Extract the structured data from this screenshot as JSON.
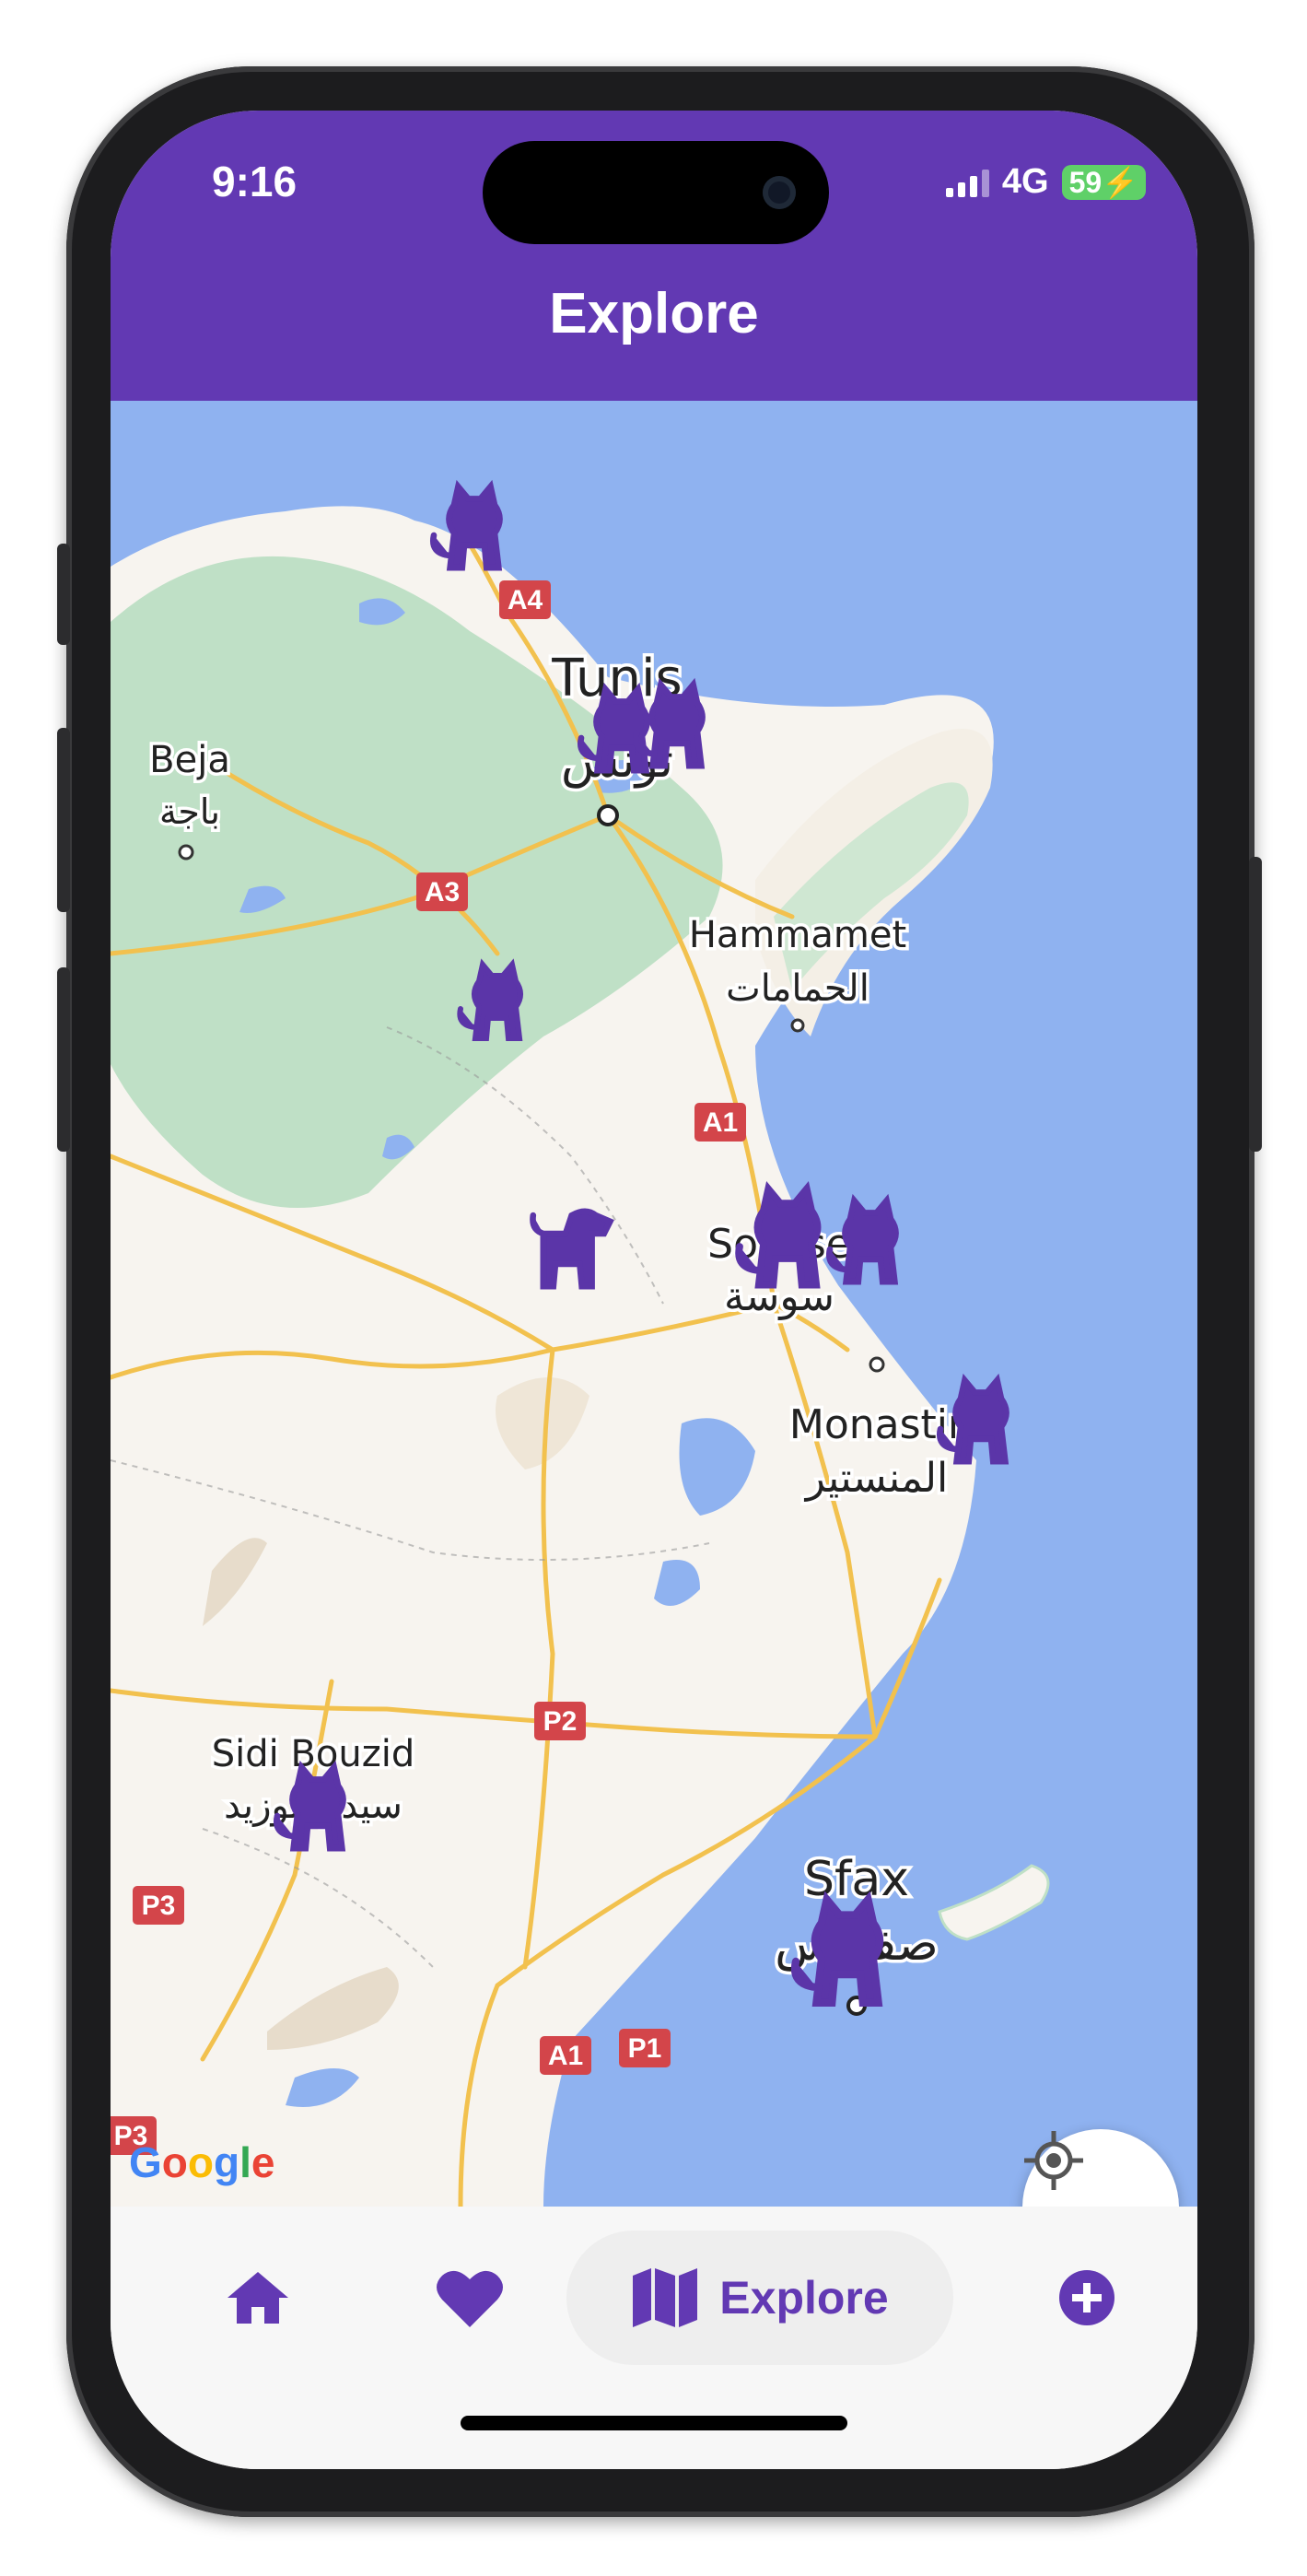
{
  "status_bar": {
    "time": "9:16",
    "network": "4G",
    "battery": "59"
  },
  "header": {
    "title": "Explore"
  },
  "map": {
    "attribution": "Google",
    "cities": [
      {
        "id": "tunis",
        "name": "Tunis",
        "name_ar": "تونس"
      },
      {
        "id": "beja",
        "name": "Beja",
        "name_ar": "باجة"
      },
      {
        "id": "hammamet",
        "name": "Hammamet",
        "name_ar": "الحمامات"
      },
      {
        "id": "sousse",
        "name": "Sousse",
        "name_ar": "سوسة"
      },
      {
        "id": "monastir",
        "name": "Monastir",
        "name_ar": "المنستير"
      },
      {
        "id": "sidi_bouzid",
        "name": "Sidi Bouzid",
        "name_ar": "سيدي بوزيد"
      },
      {
        "id": "sfax",
        "name": "Sfax",
        "name_ar": "صفاقس"
      }
    ],
    "roads": [
      "A4",
      "A3",
      "A1",
      "P2",
      "P3",
      "A1",
      "P1",
      "P3"
    ],
    "pet_markers": [
      "cat",
      "cat",
      "cat",
      "dog",
      "cat",
      "cat",
      "cat",
      "cat",
      "cat",
      "cat"
    ],
    "colors": {
      "water": "#8fb2f0",
      "land": "#f7f4ef",
      "forest": "#bfe0c6",
      "road": "#f2c14e",
      "marker": "#5b35a8",
      "shield": "#d3454a"
    }
  },
  "nav": {
    "items": [
      {
        "id": "home",
        "icon": "home-icon"
      },
      {
        "id": "favorites",
        "icon": "heart-icon"
      },
      {
        "id": "explore",
        "icon": "map-icon",
        "label": "Explore"
      },
      {
        "id": "add",
        "icon": "plus-circle-icon"
      }
    ]
  },
  "accent": "#6239b3"
}
